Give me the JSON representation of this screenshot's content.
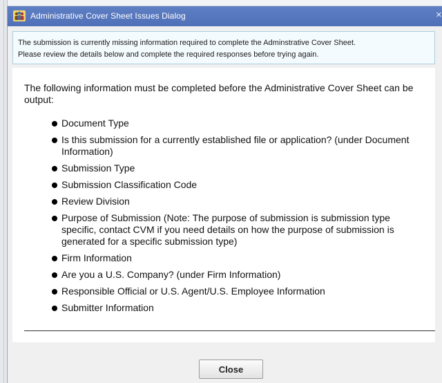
{
  "window": {
    "title": "Administrative Cover Sheet Issues Dialog",
    "close_glyph": "×",
    "app_icon": "people-icon"
  },
  "banner": {
    "line1": "The submission is currently missing information required to complete the Adminstrative Cover Sheet.",
    "line2": "Please review the details below and complete the required responses before trying again."
  },
  "content": {
    "intro": "The following information must be completed before the Administrative Cover Sheet can be output:",
    "items": [
      "Document Type",
      "Is this submission for a currently established file or application? (under Document Information)",
      "Submission Type",
      "Submission Classification Code",
      "Review Division",
      "Purpose of Submission (Note: The purpose of submission is submission type specific, contact CVM if you need details on how the purpose of submission is generated for a specific submission type)",
      "Firm Information",
      "Are you a U.S. Company? (under Firm Information)",
      "Responsible Official or U.S. Agent/U.S. Employee Information",
      "Submitter Information"
    ]
  },
  "buttons": {
    "close": "Close"
  },
  "colors": {
    "titlebar": "#5577be",
    "banner_background": "#f4fbfe",
    "banner_border": "#a9cfe0"
  }
}
